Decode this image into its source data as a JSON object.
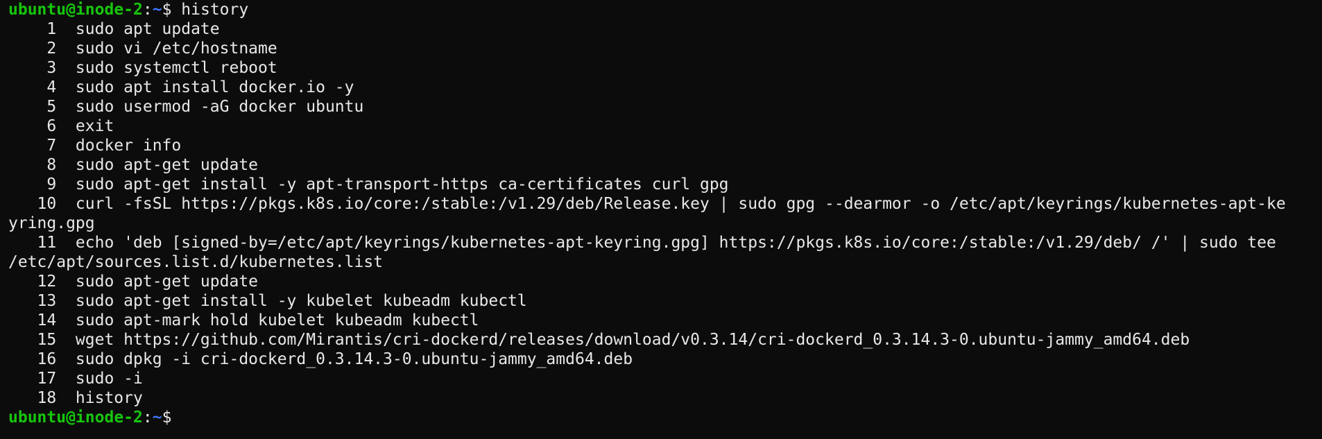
{
  "prompt": {
    "user_host": "ubuntu@inode-2",
    "separator": ":",
    "path": "~",
    "symbol": "$ "
  },
  "first_command": "history",
  "history": [
    {
      "num": "1",
      "cmd": "sudo apt update"
    },
    {
      "num": "2",
      "cmd": "sudo vi /etc/hostname"
    },
    {
      "num": "3",
      "cmd": "sudo systemctl reboot"
    },
    {
      "num": "4",
      "cmd": "sudo apt install docker.io -y"
    },
    {
      "num": "5",
      "cmd": "sudo usermod -aG docker ubuntu"
    },
    {
      "num": "6",
      "cmd": "exit"
    },
    {
      "num": "7",
      "cmd": "docker info"
    },
    {
      "num": "8",
      "cmd": "sudo apt-get update"
    },
    {
      "num": "9",
      "cmd": "sudo apt-get install -y apt-transport-https ca-certificates curl gpg"
    },
    {
      "num": "10",
      "cmd": "curl -fsSL https://pkgs.k8s.io/core:/stable:/v1.29/deb/Release.key | sudo gpg --dearmor -o /etc/apt/keyrings/kubernetes-apt-ke",
      "cont": "yring.gpg"
    },
    {
      "num": "11",
      "cmd": "echo 'deb [signed-by=/etc/apt/keyrings/kubernetes-apt-keyring.gpg] https://pkgs.k8s.io/core:/stable:/v1.29/deb/ /' | sudo tee",
      "cont": "/etc/apt/sources.list.d/kubernetes.list"
    },
    {
      "num": "12",
      "cmd": "sudo apt-get update"
    },
    {
      "num": "13",
      "cmd": "sudo apt-get install -y kubelet kubeadm kubectl"
    },
    {
      "num": "14",
      "cmd": "sudo apt-mark hold kubelet kubeadm kubectl"
    },
    {
      "num": "15",
      "cmd": "wget https://github.com/Mirantis/cri-dockerd/releases/download/v0.3.14/cri-dockerd_0.3.14.3-0.ubuntu-jammy_amd64.deb"
    },
    {
      "num": "16",
      "cmd": "sudo dpkg -i cri-dockerd_0.3.14.3-0.ubuntu-jammy_amd64.deb"
    },
    {
      "num": "17",
      "cmd": "sudo -i"
    },
    {
      "num": "18",
      "cmd": "history"
    }
  ]
}
